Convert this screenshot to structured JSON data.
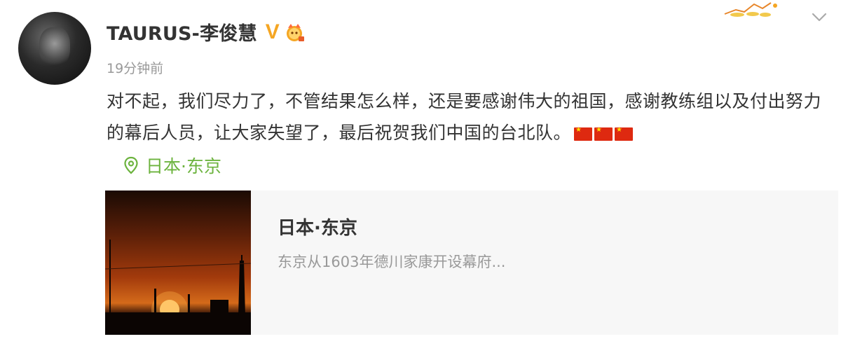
{
  "post": {
    "username": "TAURUS-李俊慧",
    "verified_mark": "V",
    "timestamp": "19分钟前",
    "content": "对不起，我们尽力了，不管结果怎么样，还是要感谢伟大的祖国，感谢教练组以及付出努力的幕后人员，让大家失望了，最后祝贺我们中国的台北队。",
    "emoji_flags": [
      "cn-flag",
      "cn-flag",
      "cn-flag"
    ],
    "location_label": "日本·东京"
  },
  "card": {
    "title": "日本·东京",
    "description": "东京从1603年德川家康开设幕府..."
  },
  "colors": {
    "accent_green": "#6cb33e",
    "verified_gold": "#f5a623",
    "text_main": "#333333",
    "text_muted": "#999999",
    "card_bg": "#f7f7f7",
    "flag_red": "#de2910"
  },
  "icons": {
    "location": "location-pin-icon",
    "vip": "vip-badge-icon",
    "menu": "chevron-down-icon"
  }
}
